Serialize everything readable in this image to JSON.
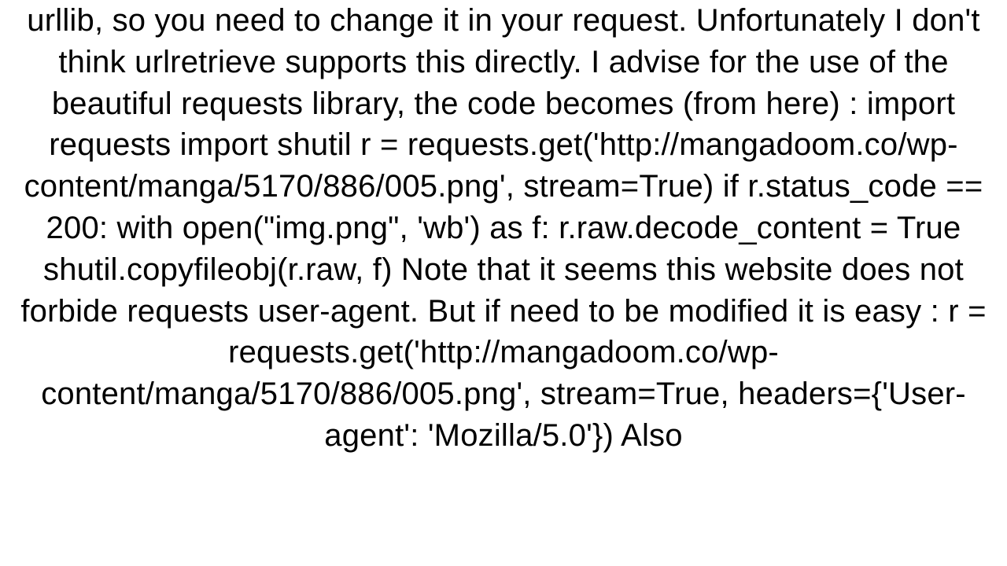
{
  "answer": {
    "body": "urllib, so you need to change it in your request. Unfortunately I don't think urlretrieve supports this directly. I advise for the use of the beautiful requests library, the code becomes (from here) : import requests import shutil  r = requests.get('http://mangadoom.co/wp-content/manga/5170/886/005.png', stream=True) if r.status_code == 200:     with open(\"img.png\", 'wb') as f:         r.raw.decode_content = True         shutil.copyfileobj(r.raw, f)  Note that it seems this website does not forbide requests user-agent. But if need to be modified it is easy : r = requests.get('http://mangadoom.co/wp-content/manga/5170/886/005.png',                  stream=True, headers={'User-agent': 'Mozilla/5.0'})  Also"
  }
}
